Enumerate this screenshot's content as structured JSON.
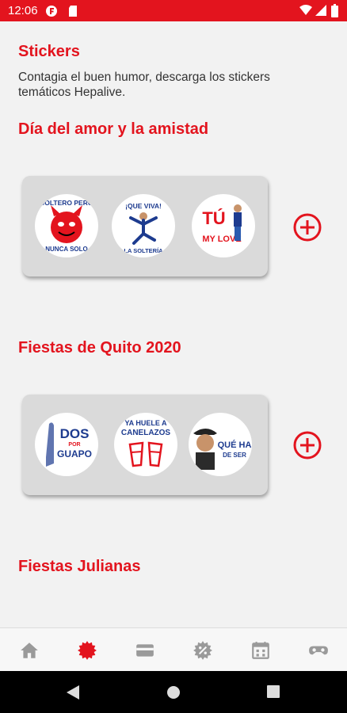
{
  "status_bar": {
    "time": "12:06"
  },
  "header": {
    "title": "Stickers",
    "description": "Contagia el buen humor, descarga los stickers temáticos Hepalive."
  },
  "sections": [
    {
      "title": "Día del amor y la amistad",
      "stickers": [
        {
          "lines": [
            "SOLTERO PERO",
            "NUNCA SOLO"
          ]
        },
        {
          "lines": [
            "¡QUE VIVA!",
            "LA SOLTERÍA"
          ]
        },
        {
          "lines": [
            "TÚ",
            "MY LOVE"
          ]
        }
      ]
    },
    {
      "title": "Fiestas de Quito 2020",
      "stickers": [
        {
          "lines": [
            "DOS",
            "POR",
            "GUAPO"
          ]
        },
        {
          "lines": [
            "YA HUELE A",
            "CANELAZOS"
          ]
        },
        {
          "lines": [
            "QUÉ HA",
            "DE SER"
          ]
        }
      ]
    },
    {
      "title": "Fiestas Julianas"
    }
  ],
  "bottom_nav": [
    "home-icon",
    "sticker-icon",
    "card-icon",
    "discount-icon",
    "calendar-icon",
    "gamepad-icon"
  ],
  "colors": {
    "accent": "#e3141e",
    "nav_inactive": "#9a9a9a",
    "sticker_blue": "#1d3b8f"
  }
}
